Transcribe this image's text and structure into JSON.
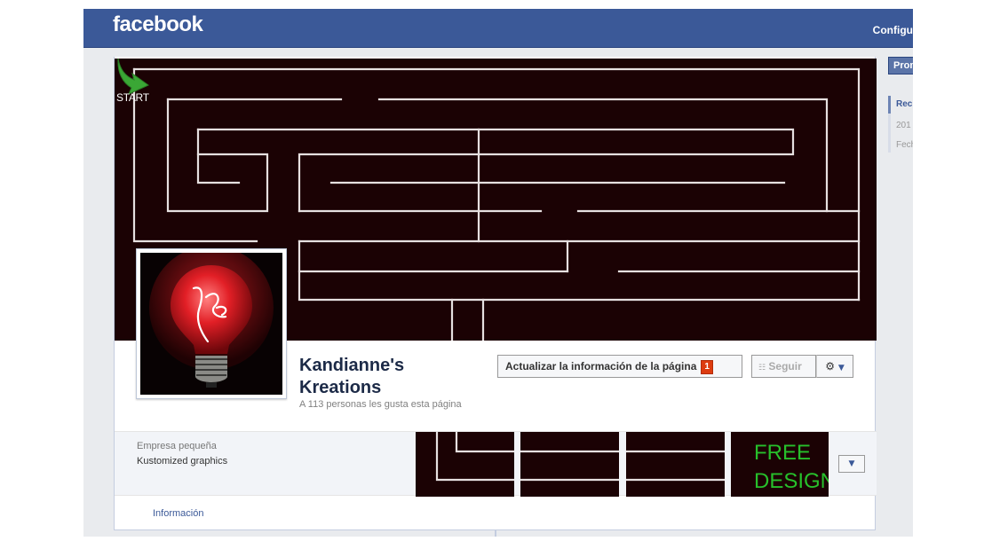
{
  "topbar": {
    "logo": "facebook",
    "config_label": "Configu"
  },
  "right_column": {
    "promote_label": "Prom",
    "items": [
      "Rec",
      "201",
      "Fech"
    ]
  },
  "cover": {
    "start_label": "START"
  },
  "page": {
    "title": "Kandianne's Kreations",
    "likes_text": "A 113 personas les gusta esta página"
  },
  "actions": {
    "update_label": "Actualizar la información de la página",
    "notification_count": "1",
    "follow_label": "Seguir",
    "rss_icon": "☷"
  },
  "about": {
    "category": "Empresa pequeña",
    "description": "Kustomized graphics"
  },
  "apps": {
    "free_line1": "FREE",
    "free_line2": "DESIGN"
  },
  "nav": {
    "info_label": "Información"
  },
  "colors": {
    "brand_blue": "#3b5998",
    "cover_background": "#1b0204",
    "maze_line": "#e6e0e0",
    "free_green": "#27c02b",
    "badge_red": "#dd3c10"
  }
}
